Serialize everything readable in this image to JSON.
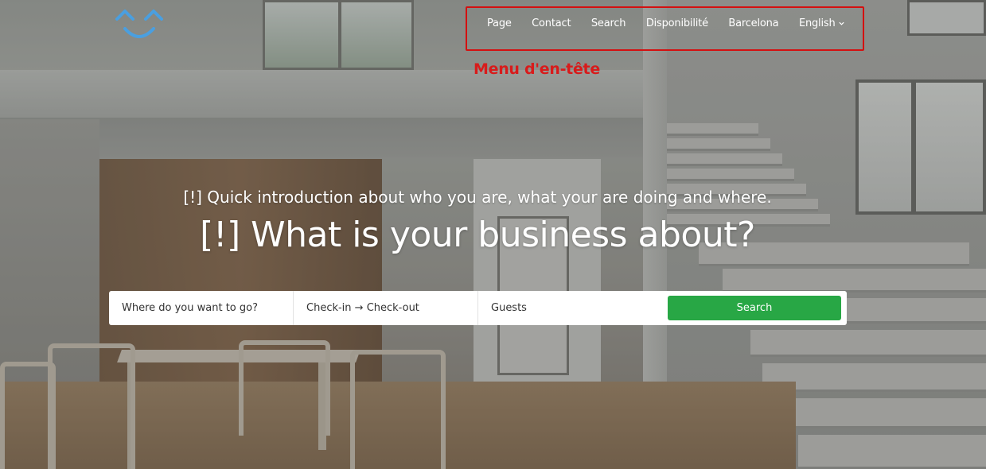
{
  "logo": {
    "icon": "smile-logo-icon",
    "color": "#4a9fe0"
  },
  "nav": {
    "items": [
      {
        "label": "Page"
      },
      {
        "label": "Contact"
      },
      {
        "label": "Search"
      },
      {
        "label": "Disponibilité"
      },
      {
        "label": "Barcelona"
      }
    ],
    "language": {
      "label": "English",
      "icon": "chevron-down-icon"
    },
    "annotation": "Menu d'en-tête",
    "annotation_color": "#d81b1b"
  },
  "hero": {
    "subtitle": "[!] Quick introduction about who you are, what your are doing and where.",
    "title": "[!] What is your business about?"
  },
  "search": {
    "destination_placeholder": "Where do you want to go?",
    "dates_placeholder": "Check-in → Check-out",
    "guests_placeholder": "Guests",
    "button_label": "Search",
    "button_color": "#28a745"
  }
}
